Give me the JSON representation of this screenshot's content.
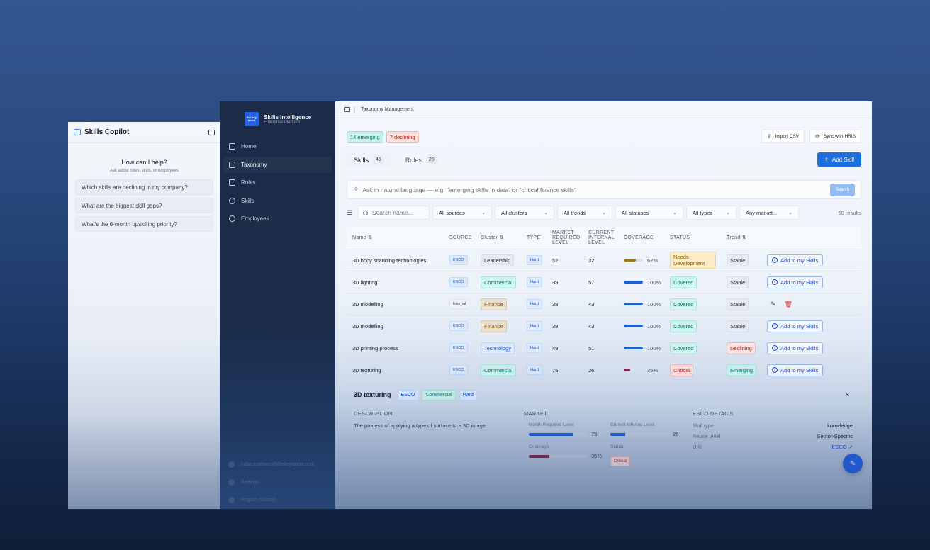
{
  "copilot": {
    "title": "Skills Copilot",
    "help_title": "How can I help?",
    "help_sub": "Ask about roles, skills, or employees",
    "suggestions": [
      "Which skills are declining in my company?",
      "What are the biggest skill gaps?",
      "What's the 6-month upskilling priority?"
    ]
  },
  "sidebar": {
    "brand_name": "Skills Intelligence",
    "brand_sub": "Enterprise Platform",
    "logo_text": "the key talent",
    "items": [
      {
        "label": "Home",
        "icon": "home-icon"
      },
      {
        "label": "Taxonomy",
        "icon": "book-icon"
      },
      {
        "label": "Roles",
        "icon": "grid-icon"
      },
      {
        "label": "Skills",
        "icon": "globe-icon"
      },
      {
        "label": "Employees",
        "icon": "users-icon"
      }
    ],
    "footer": {
      "email": "india.martinez@thekeytalent.com",
      "settings": "Settings",
      "language": "English (Global)"
    }
  },
  "topbar": {
    "breadcrumb": "Taxonomy Management"
  },
  "badges": {
    "emerging": "14 emerging",
    "declining": "7 declining"
  },
  "actions": {
    "import": "Import CSV",
    "sync": "Sync with HRIS",
    "add_skill": "Add Skill"
  },
  "tabs": {
    "skills_label": "Skills",
    "skills_count": "45",
    "roles_label": "Roles",
    "roles_count": "20"
  },
  "nl_search": {
    "placeholder": "Ask in natural language — e.g. \"emerging skills in data\" or \"critical finance skills\"",
    "button": "Search"
  },
  "filters": {
    "search_placeholder": "Search name...",
    "sources": "All sources",
    "clusters": "All clusters",
    "trends": "All trends",
    "statuses": "All statuses",
    "types": "All types",
    "market": "Any market...",
    "results": "50 results"
  },
  "table": {
    "headers": {
      "name": "Name ⇅",
      "source": "SOURCE",
      "cluster": "Cluster ⇅",
      "type": "TYPE",
      "mrl": "MARKET REQUIRED LEVEL",
      "cil": "CURRENT INTERNAL LEVEL",
      "coverage": "COVERAGE",
      "status": "STATUS",
      "trend": "Trend ⇅"
    },
    "add_label": "Add to my Skills",
    "rows": [
      {
        "name": "3D body scanning technologies",
        "source": "ESCO",
        "cluster": "Leadership",
        "type": "Hard",
        "mrl": "52",
        "cil": "32",
        "coverage": 62,
        "coverage_label": "62%",
        "status": "Needs Development",
        "trend": "Stable",
        "action": "add"
      },
      {
        "name": "3D lighting",
        "source": "ESCO",
        "cluster": "Commercial",
        "type": "Hard",
        "mrl": "33",
        "cil": "57",
        "coverage": 100,
        "coverage_label": "100%",
        "status": "Covered",
        "trend": "Stable",
        "action": "add"
      },
      {
        "name": "3D modelling",
        "source": "Internal",
        "cluster": "Finance",
        "type": "Hard",
        "mrl": "38",
        "cil": "43",
        "coverage": 100,
        "coverage_label": "100%",
        "status": "Covered",
        "trend": "Stable",
        "action": "edit"
      },
      {
        "name": "3D modelling",
        "source": "ESCO",
        "cluster": "Finance",
        "type": "Hard",
        "mrl": "38",
        "cil": "43",
        "coverage": 100,
        "coverage_label": "100%",
        "status": "Covered",
        "trend": "Stable",
        "action": "add"
      },
      {
        "name": "3D printing process",
        "source": "ESCO",
        "cluster": "Technology",
        "type": "Hard",
        "mrl": "49",
        "cil": "51",
        "coverage": 100,
        "coverage_label": "100%",
        "status": "Covered",
        "trend": "Declining",
        "action": "add"
      },
      {
        "name": "3D texturing",
        "source": "ESCO",
        "cluster": "Commercial",
        "type": "Hard",
        "mrl": "75",
        "cil": "26",
        "coverage": 35,
        "coverage_label": "35%",
        "status": "Critical",
        "trend": "Emerging",
        "action": "add"
      }
    ]
  },
  "detail": {
    "title": "3D texturing",
    "tags": [
      "ESCO",
      "Commercial",
      "Hard"
    ],
    "description_label": "DESCRIPTION",
    "description": "The process of applying a type of surface to a 3D image.",
    "market_label": "MARKET",
    "market": {
      "mrl_label": "Month Required Level",
      "mrl_value": "75",
      "mrl_fill": 75,
      "cil_label": "Current Internal Level",
      "cil_value": "26",
      "cil_fill": 26,
      "coverage_label": "Coverage",
      "coverage_value": "35%",
      "coverage_fill": 35,
      "status_label": "Status",
      "status_value": "Critical"
    },
    "esco_label": "ESCO DETAILS",
    "esco": {
      "type_k": "Skill type",
      "type_v": "knowledge",
      "reuse_k": "Reuse level",
      "reuse_v": "Sector-Specific",
      "uri_k": "URI",
      "uri_v": "ESCO ↗"
    }
  },
  "colors": {
    "accent": "#1d6fe0",
    "coverage_low": "#9a7a10",
    "coverage_full": "#1d5fd6",
    "coverage_critical": "#8b2743"
  }
}
